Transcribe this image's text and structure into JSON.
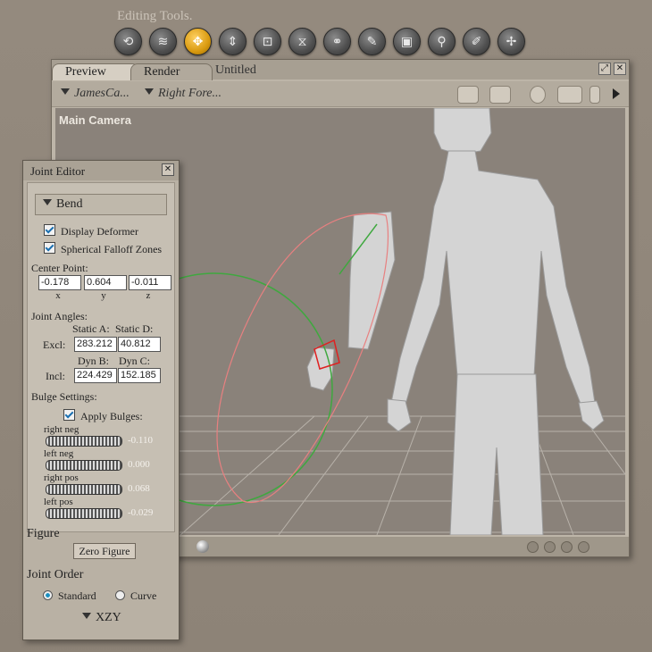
{
  "editing_tools": {
    "label": "Editing Tools.",
    "tools": [
      {
        "icon": "rotate-icon",
        "glyph": "⟲",
        "active": false
      },
      {
        "icon": "twist-icon",
        "glyph": "≋",
        "active": false
      },
      {
        "icon": "translate-icon",
        "glyph": "✥",
        "active": true
      },
      {
        "icon": "translate-in-out-icon",
        "glyph": "⇕",
        "active": false
      },
      {
        "icon": "scale-icon",
        "glyph": "⊡",
        "active": false
      },
      {
        "icon": "taper-icon",
        "glyph": "⧖",
        "active": false
      },
      {
        "icon": "chain-break-icon",
        "glyph": "⚭",
        "active": false
      },
      {
        "icon": "color-icon",
        "glyph": "✎",
        "active": false
      },
      {
        "icon": "grouping-icon",
        "glyph": "▣",
        "active": false
      },
      {
        "icon": "view-magnifier-icon",
        "glyph": "⚲",
        "active": false
      },
      {
        "icon": "morph-brush-icon",
        "glyph": "✐",
        "active": false
      },
      {
        "icon": "direct-manipulation-icon",
        "glyph": "✢",
        "active": false
      }
    ]
  },
  "main_window": {
    "tabs": [
      "Preview",
      "Render"
    ],
    "doc_title": "Untitled",
    "figure_dropdown": "JamesCa...",
    "part_dropdown": "Right Fore...",
    "camera_label": "Main Camera"
  },
  "joint_editor": {
    "title": "Joint Editor",
    "mode": "Bend",
    "display_deformer": "Display Deformer",
    "spherical_falloff": "Spherical Falloff Zones",
    "center_point_label": "Center Point:",
    "center": {
      "x": "-0.178",
      "y": "0.604",
      "z": "-0.011"
    },
    "axis_labels": {
      "x": "x",
      "y": "y",
      "z": "z"
    },
    "joint_angles_label": "Joint Angles:",
    "static_a_label": "Static A:",
    "static_d_label": "Static D:",
    "excl_label": "Excl:",
    "static_a": "283.212",
    "static_d": "40.812",
    "dyn_b_label": "Dyn B:",
    "dyn_c_label": "Dyn C:",
    "incl_label": "Incl:",
    "dyn_b": "224.429",
    "dyn_c": "152.185",
    "bulge_label": "Bulge Settings:",
    "apply_bulges": "Apply Bulges:",
    "bulges": [
      {
        "label": "right neg",
        "value": "-0.110"
      },
      {
        "label": "left neg",
        "value": "0.000"
      },
      {
        "label": "right pos",
        "value": "0.068"
      },
      {
        "label": "left pos",
        "value": "-0.029"
      }
    ],
    "figure_label": "Figure",
    "zero_figure": "Zero Figure",
    "joint_order_label": "Joint Order",
    "standard": "Standard",
    "curve": "Curve",
    "order": "XZY"
  }
}
